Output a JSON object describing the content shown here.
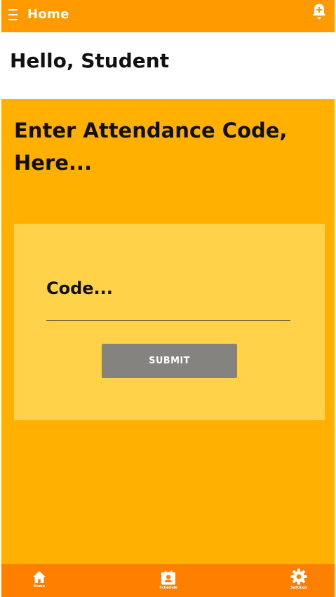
{
  "appbar": {
    "title": "Home",
    "menu_icon": "menu-icon",
    "notification_icon": "bell-plus-icon"
  },
  "greeting": "Hello, Student",
  "main": {
    "prompt": "Enter Attendance Code, Here...",
    "code_field": {
      "label": "Code...",
      "value": "",
      "placeholder": ""
    },
    "submit_label": "SUBMIT"
  },
  "bottomnav": {
    "items": [
      {
        "label": "Home",
        "icon": "home-icon"
      },
      {
        "label": "Schedule",
        "icon": "schedule-icon"
      },
      {
        "label": "Settings",
        "icon": "gear-icon"
      }
    ]
  },
  "colors": {
    "appbar": "#ff9a00",
    "main_background": "#ffb000",
    "card": "#ffd24a",
    "button": "#85837f",
    "bottomnav": "#ff8000"
  }
}
